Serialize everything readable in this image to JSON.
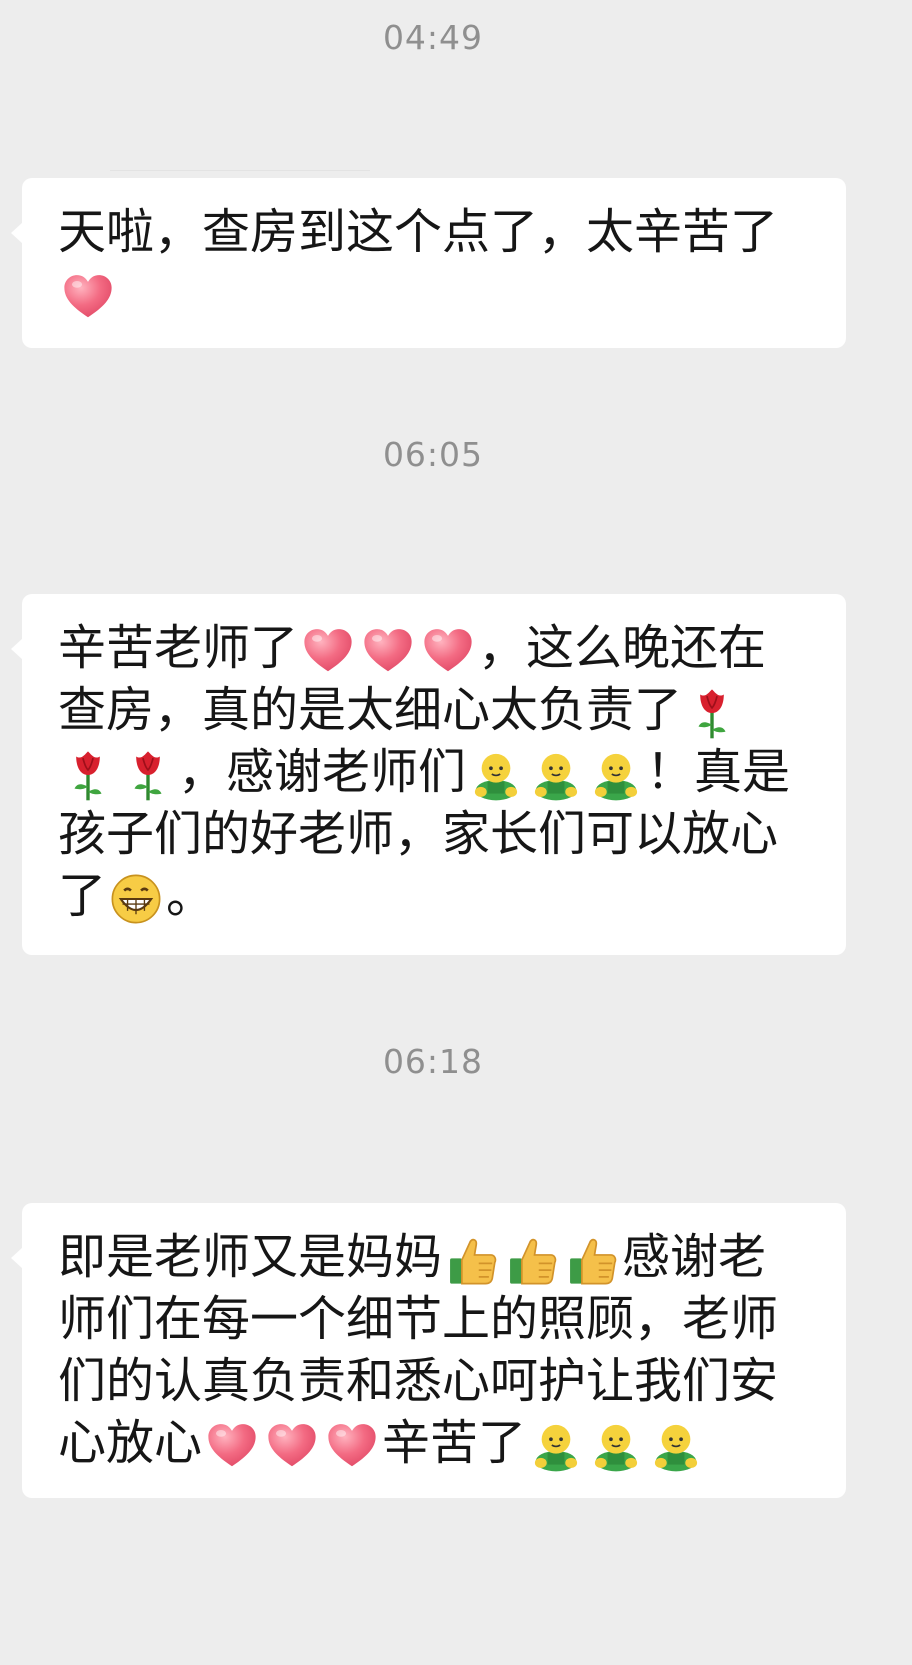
{
  "colors": {
    "background": "#ededed",
    "bubble": "#ffffff",
    "timestamp": "#8f8f8f",
    "text": "#161616"
  },
  "messages": [
    {
      "time": "04:49",
      "lines": [
        [
          "天啦，查房到这个点了，太辛苦了"
        ],
        [
          {
            "icon": "heart-emoji"
          }
        ]
      ]
    },
    {
      "time": "06:05",
      "lines": [
        [
          "辛苦老师了",
          {
            "icon": "heart-emoji"
          },
          {
            "icon": "heart-emoji"
          },
          {
            "icon": "heart-emoji"
          },
          "，这么晚还在"
        ],
        [
          "查房，真的是太细心太负责了",
          {
            "icon": "rose-emoji"
          }
        ],
        [
          {
            "icon": "rose-emoji"
          },
          {
            "icon": "rose-emoji"
          },
          "，感谢老师们",
          {
            "icon": "bow-emoji"
          },
          {
            "icon": "bow-emoji"
          },
          {
            "icon": "bow-emoji"
          },
          "！真是"
        ],
        [
          "孩子们的好老师，家长们可以放心"
        ],
        [
          "了",
          {
            "icon": "grin-emoji"
          },
          "。"
        ]
      ]
    },
    {
      "time": "06:18",
      "lines": [
        [
          "即是老师又是妈妈",
          {
            "icon": "thumbs-up-emoji"
          },
          {
            "icon": "thumbs-up-emoji"
          },
          {
            "icon": "thumbs-up-emoji"
          },
          "感谢老"
        ],
        [
          "师们在每一个细节上的照顾，老师"
        ],
        [
          "们的认真负责和悉心呵护让我们安"
        ],
        [
          "心放心",
          {
            "icon": "heart-emoji"
          },
          {
            "icon": "heart-emoji"
          },
          {
            "icon": "heart-emoji"
          },
          "辛苦了",
          {
            "icon": "bow-emoji"
          },
          {
            "icon": "bow-emoji"
          },
          {
            "icon": "bow-emoji"
          }
        ]
      ]
    }
  ]
}
